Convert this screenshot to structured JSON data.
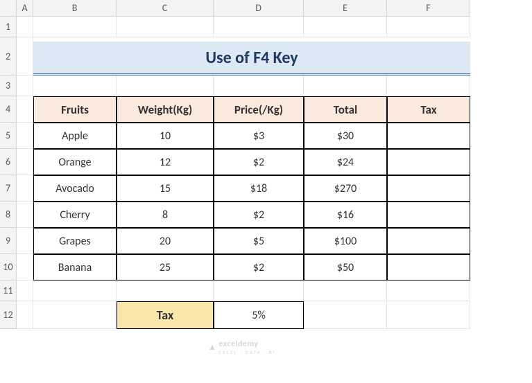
{
  "columns": [
    "A",
    "B",
    "C",
    "D",
    "E",
    "F"
  ],
  "rows": [
    "1",
    "2",
    "3",
    "4",
    "5",
    "6",
    "7",
    "8",
    "9",
    "10",
    "11",
    "12"
  ],
  "title": "Use of F4 Key",
  "table": {
    "headers": [
      "Fruits",
      "Weight(Kg)",
      "Price(/Kg)",
      "Total",
      "Tax"
    ],
    "data": [
      [
        "Apple",
        "10",
        "$3",
        "$30",
        ""
      ],
      [
        "Orange",
        "12",
        "$2",
        "$24",
        ""
      ],
      [
        "Avocado",
        "15",
        "$18",
        "$270",
        ""
      ],
      [
        "Cherry",
        "8",
        "$2",
        "$16",
        ""
      ],
      [
        "Grapes",
        "20",
        "$5",
        "$100",
        ""
      ],
      [
        "Banana",
        "25",
        "$2",
        "$50",
        ""
      ]
    ]
  },
  "tax_row": {
    "label": "Tax",
    "value": "5%"
  },
  "watermark": {
    "text": "exceldemy",
    "sub": "EXCEL · DATA · BI"
  },
  "chart_data": {
    "type": "table",
    "title": "Use of F4 Key",
    "columns": [
      "Fruits",
      "Weight(Kg)",
      "Price(/Kg)",
      "Total",
      "Tax"
    ],
    "rows": [
      {
        "Fruits": "Apple",
        "Weight(Kg)": 10,
        "Price(/Kg)": 3,
        "Total": 30,
        "Tax": null
      },
      {
        "Fruits": "Orange",
        "Weight(Kg)": 12,
        "Price(/Kg)": 2,
        "Total": 24,
        "Tax": null
      },
      {
        "Fruits": "Avocado",
        "Weight(Kg)": 15,
        "Price(/Kg)": 18,
        "Total": 270,
        "Tax": null
      },
      {
        "Fruits": "Cherry",
        "Weight(Kg)": 8,
        "Price(/Kg)": 2,
        "Total": 16,
        "Tax": null
      },
      {
        "Fruits": "Grapes",
        "Weight(Kg)": 20,
        "Price(/Kg)": 5,
        "Total": 100,
        "Tax": null
      },
      {
        "Fruits": "Banana",
        "Weight(Kg)": 25,
        "Price(/Kg)": 2,
        "Total": 50,
        "Tax": null
      }
    ],
    "extras": {
      "tax_rate": 0.05
    }
  }
}
